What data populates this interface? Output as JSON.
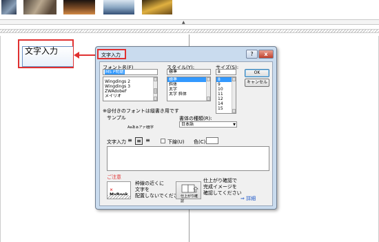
{
  "thumbs": [
    {
      "color": "#5a6a80"
    },
    {
      "color": "#7a6a55"
    },
    {
      "color": "#3a2a20"
    },
    {
      "color": "#9ab0c8"
    },
    {
      "color": "#b08830"
    }
  ],
  "canvas": {
    "textbox_label": "文字入力",
    "collapse_arrow": "▲"
  },
  "dialog": {
    "title": "文字入力",
    "help": "?",
    "close": "x",
    "font_label": "フォント名(F)",
    "font_value": "MS P明朝",
    "font_list": [
      "Wingdings 2",
      "Wingdings 3",
      "ZWAdobeF",
      "メイリオ"
    ],
    "style_label": "スタイル(Y):",
    "style_value": "標準",
    "style_list": [
      "標準",
      "斜体",
      "太字",
      "太字 斜体"
    ],
    "size_label": "サイズ(S):",
    "size_value": "8",
    "size_list": [
      "8",
      "9",
      "10",
      "11",
      "12",
      "14",
      "15"
    ],
    "ok": "OK",
    "cancel": "キャンセル",
    "vertical_note": "※@付きのフォントは縦書き用です",
    "sample_label": "サンプル",
    "sample_text": "AaあぁアァⅠ亜字",
    "script_label": "書体の種類(R):",
    "script_value": "日本語",
    "input_label": "文字入力",
    "underline_label": "下線(U)",
    "color_label": "色(C):",
    "notice_label": "ご注意",
    "mybook_prefix": "×",
    "mybook_label": "MyBook",
    "notice_text": [
      "枠線の近くに",
      "文字を",
      "配置しないでください"
    ],
    "finish_button_label": "仕上がり確認",
    "finish_text": [
      "仕上がり確認で",
      "完成イメージを",
      "確認してください"
    ],
    "detail_link": "⇒ 詳細"
  },
  "colors": {
    "accent_red": "#e03030",
    "link_blue": "#1a55c8",
    "selection": "#3399ff"
  }
}
